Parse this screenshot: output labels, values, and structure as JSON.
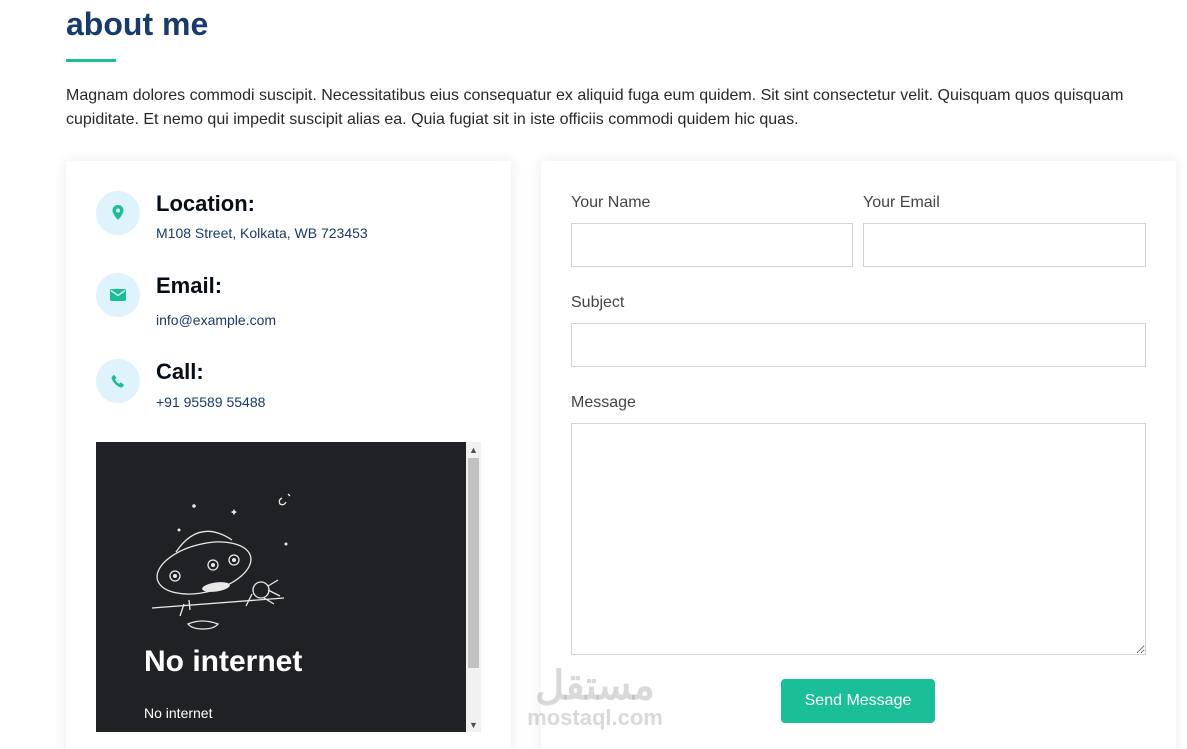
{
  "section": {
    "title": "about me",
    "intro": "Magnam dolores commodi suscipit. Necessitatibus eius consequatur ex aliquid fuga eum quidem. Sit sint consectetur velit. Quisquam quos quisquam cupiditate. Et nemo qui impedit suscipit alias ea. Quia fugiat sit in iste officiis commodi quidem hic quas."
  },
  "contact_info": {
    "location": {
      "label": "Location:",
      "value": "M108 Street, Kolkata, WB 723453",
      "icon": "map-pin-icon"
    },
    "email": {
      "label": "Email:",
      "value": "info@example.com",
      "icon": "envelope-icon"
    },
    "call": {
      "label": "Call:",
      "value": "+91 95589 55488",
      "icon": "phone-icon"
    }
  },
  "map_embed": {
    "title": "No internet",
    "subtitle": "No internet"
  },
  "form": {
    "name_label": "Your Name",
    "name_value": "",
    "email_label": "Your Email",
    "email_value": "",
    "subject_label": "Subject",
    "subject_value": "",
    "message_label": "Message",
    "message_value": "",
    "submit_label": "Send Message"
  },
  "watermark": {
    "arabic": "مستقل",
    "latin": "mostaql.com"
  },
  "colors": {
    "accent": "#1bbf97",
    "heading": "#173b6c",
    "icon_bg": "#dff3fc"
  }
}
